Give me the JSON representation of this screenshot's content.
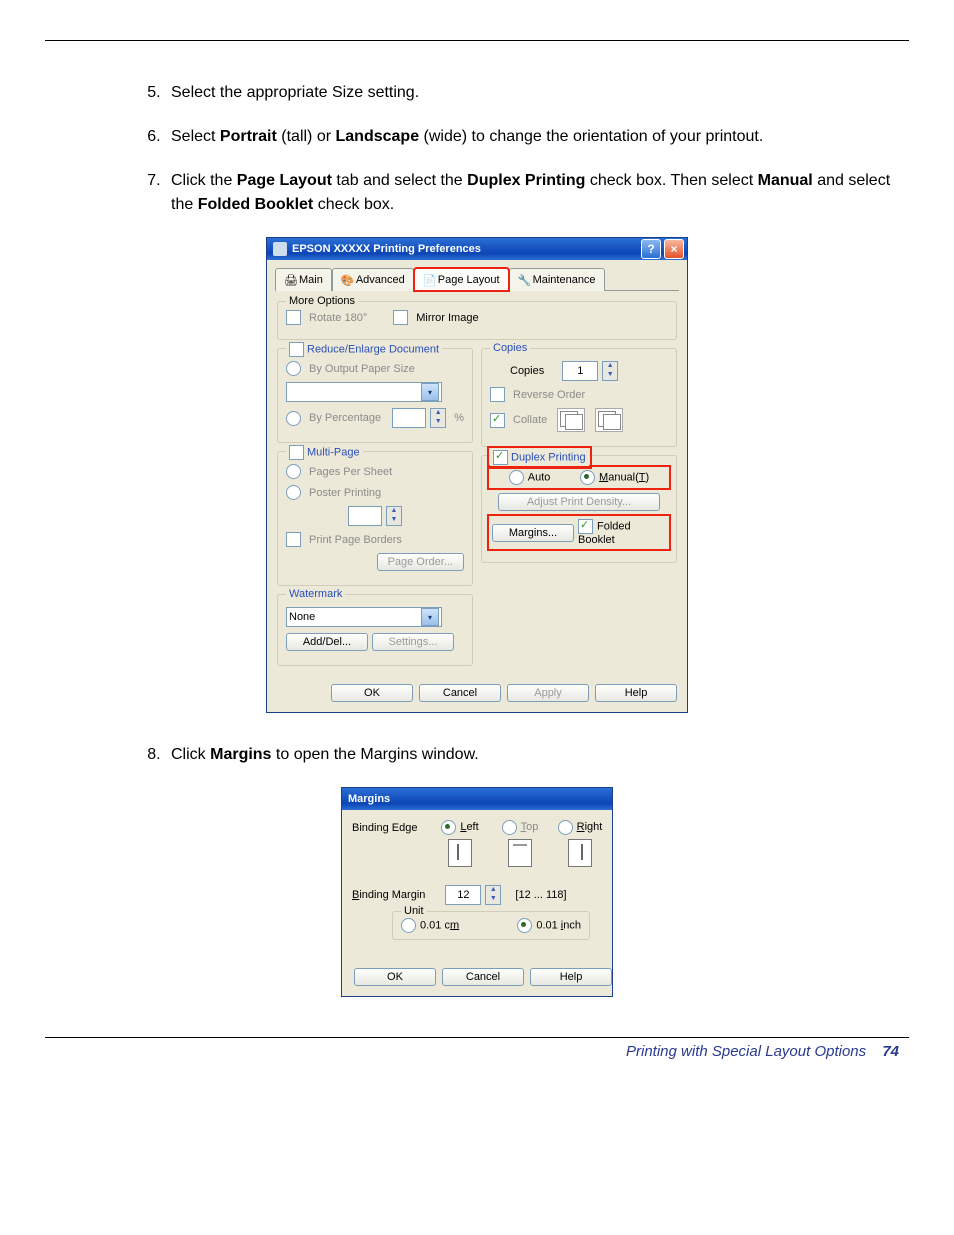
{
  "instructions": {
    "step5": "Select the appropriate Size setting.",
    "step6_a": "Select ",
    "step6_b": "Portrait",
    "step6_c": " (tall) or ",
    "step6_d": "Landscape",
    "step6_e": " (wide) to change the orientation of your printout.",
    "step7_a": "Click the ",
    "step7_b": "Page Layout",
    "step7_c": " tab and select the ",
    "step7_d": "Duplex Printing",
    "step7_e": " check box. Then select ",
    "step7_f": "Manual",
    "step7_g": " and select the ",
    "step7_h": "Folded Booklet",
    "step7_i": " check box.",
    "step8_a": "Click ",
    "step8_b": "Margins",
    "step8_c": " to open the Margins window."
  },
  "dialog1": {
    "title": "EPSON   XXXXX  Printing Preferences",
    "tabs": {
      "main": "Main",
      "advanced": "Advanced",
      "page_layout": "Page Layout",
      "maintenance": "Maintenance"
    },
    "more_options": {
      "legend": "More Options",
      "rotate": "Rotate 180°",
      "mirror": "Mirror Image"
    },
    "reduce_enlarge": {
      "legend": "Reduce/Enlarge Document",
      "by_output": "By Output Paper Size",
      "by_percent": "By Percentage",
      "percent_unit": "%"
    },
    "multi_page": {
      "legend": "Multi-Page",
      "per_sheet": "Pages Per Sheet",
      "poster": "Poster Printing",
      "borders": "Print Page Borders",
      "page_order": "Page Order..."
    },
    "watermark": {
      "legend": "Watermark",
      "none": "None",
      "add_del": "Add/Del...",
      "settings": "Settings..."
    },
    "copies": {
      "legend": "Copies",
      "label": "Copies",
      "value": "1",
      "reverse": "Reverse Order",
      "collate": "Collate"
    },
    "duplex": {
      "label": "Duplex Printing",
      "auto": "Auto",
      "manual": "Manual(T)",
      "adjust": "Adjust Print Density...",
      "margins": "Margins...",
      "folded": "Folded Booklet"
    },
    "footer": {
      "ok": "OK",
      "cancel": "Cancel",
      "apply": "Apply",
      "help": "Help"
    }
  },
  "dialog2": {
    "title": "Margins",
    "binding_edge": "Binding Edge",
    "left": "Left",
    "top": "Top",
    "right": "Right",
    "binding_margin": "Binding Margin",
    "margin_value": "12",
    "margin_range": "[12 ... 118]",
    "unit_legend": "Unit",
    "unit_cm": "0.01 cm",
    "unit_inch": "0.01 inch",
    "ok": "OK",
    "cancel": "Cancel",
    "help": "Help"
  },
  "footer": {
    "section": "Printing with Special Layout Options",
    "page": "74"
  }
}
